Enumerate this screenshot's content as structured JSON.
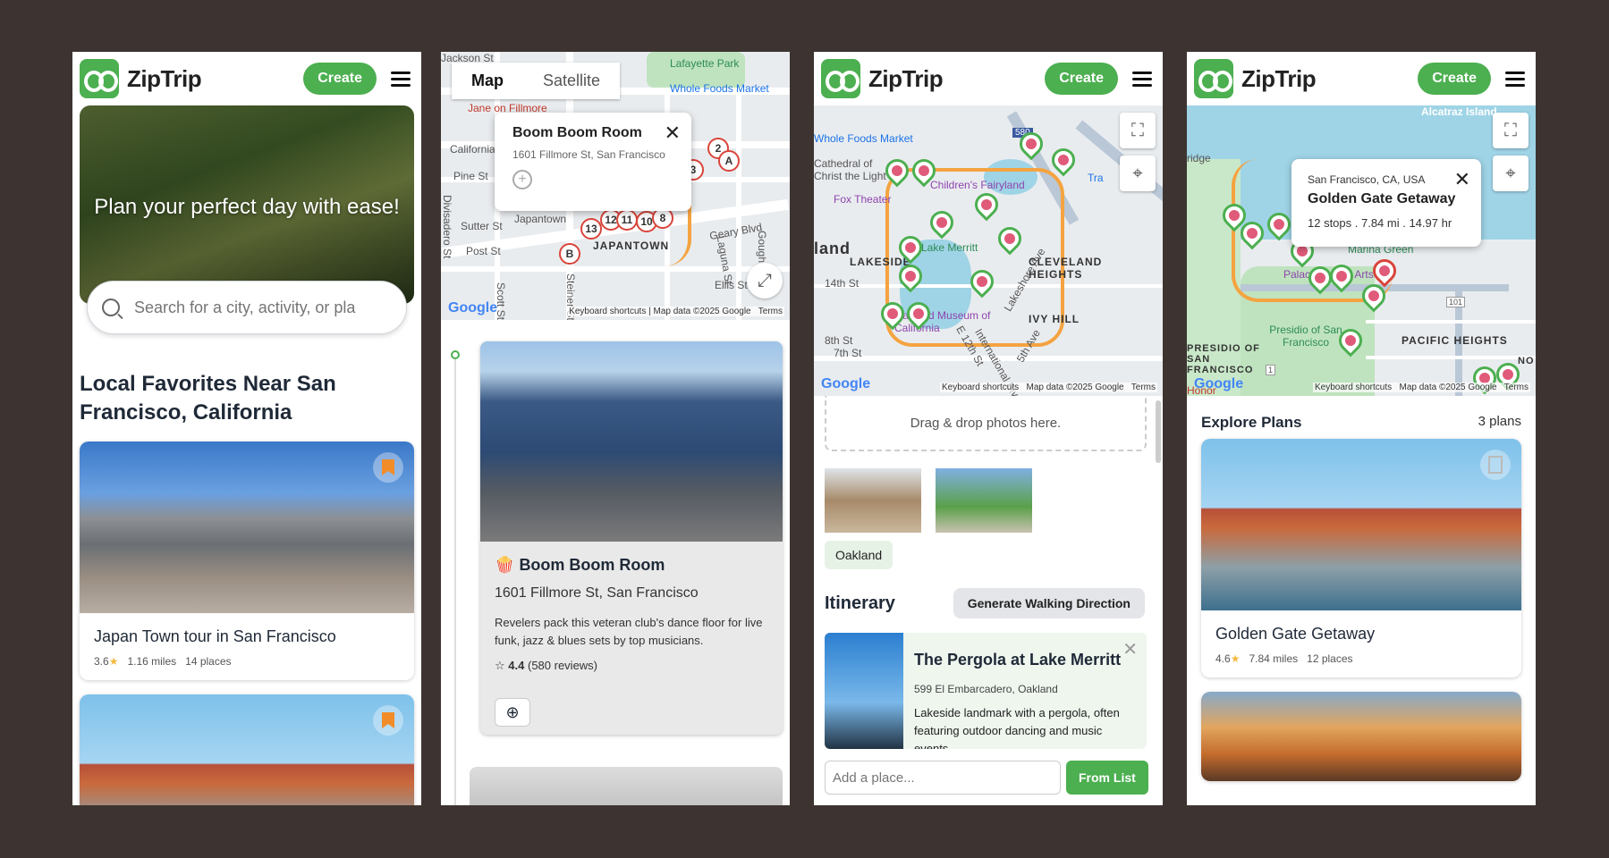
{
  "app": {
    "name": "ZipTrip",
    "create_label": "Create"
  },
  "panel1": {
    "hero_text": "Plan your perfect day with ease!",
    "search_placeholder": "Search for a city, activity, or pla",
    "section_title": "Local Favorites Near San Francisco, California",
    "cards": [
      {
        "title": "Japan Town tour in San Francisco",
        "rating": "3.6",
        "distance": "1.16 miles",
        "places": "14 places"
      },
      {
        "title": "",
        "rating": "",
        "distance": "",
        "places": ""
      }
    ]
  },
  "panel2": {
    "tabs": [
      "Map",
      "Satellite"
    ],
    "map_labels": [
      "Jackson St",
      "Lafayette Park",
      "Whole Foods Market",
      "Jane on Fillmore",
      "California St",
      "Pine St",
      "Sutter St",
      "Post St",
      "Divisadero St",
      "Japantown",
      "JAPANTOWN",
      "Geary Blvd",
      "Laguna St",
      "Ellis St",
      "Gough St",
      "Steiner St",
      "Scott St"
    ],
    "pins": [
      "2",
      "A",
      "3",
      "13",
      "12",
      "11",
      "10",
      "8",
      "B"
    ],
    "info": {
      "title": "Boom Boom Room",
      "address": "1601 Fillmore St, San Francisco"
    },
    "place": {
      "title": "Boom Boom Room",
      "address": "1601 Fillmore St, San Francisco",
      "description": "Revelers pack this veteran club's dance floor for live funk, jazz & blues sets by top musicians.",
      "rating": "4.4",
      "reviews": "(580 reviews)"
    },
    "attribution": {
      "shortcuts": "Keyboard shortcuts",
      "data": "Map data ©2025 Google",
      "terms": "Terms"
    }
  },
  "panel3": {
    "map_labels": [
      "Whole Foods Market",
      "Cathedral of Christ the Light",
      "Children's Fairyland",
      "Fox Theater",
      "Lake Merritt",
      "LAKESIDE",
      "CLEVELAND HEIGHTS",
      "IVY HILL",
      "Oakland Museum of California",
      "14th St",
      "8th St",
      "7th St",
      "5th Ave",
      "E 12th St",
      "International Blvd",
      "Lakeshore Ave",
      "land",
      "Tra",
      "580"
    ],
    "drop_text": "Drag & drop photos here.",
    "tag": "Oakland",
    "itinerary_title": "Itinerary",
    "generate_label": "Generate Walking Direction",
    "item": {
      "title": "The Pergola at Lake Merritt",
      "address": "599 El Embarcadero, Oakland",
      "description": "Lakeside landmark with a pergola, often featuring outdoor dancing and music events."
    },
    "add_placeholder": "Add a place...",
    "from_list_label": "From List",
    "attribution": {
      "shortcuts": "Keyboard shortcuts",
      "data": "Map data ©2025 Google",
      "terms": "Terms"
    }
  },
  "panel4": {
    "map_labels": [
      "Alcatraz Island",
      "Palace of Fine Arts",
      "Marina Green",
      "Presidio of San Francisco",
      "PACIFIC HEIGHTS",
      "PRESIDIO OF SAN FRANCISCO",
      "101",
      "1",
      "ridge",
      "Honor",
      "NO"
    ],
    "info": {
      "city": "San Francisco, CA, USA",
      "title": "Golden Gate Getaway",
      "stats": "12 stops . 7.84 mi . 14.97 hr"
    },
    "explore_title": "Explore Plans",
    "plan_count": "3 plans",
    "cards": [
      {
        "title": "Golden Gate Getaway",
        "rating": "4.6",
        "distance": "7.84 miles",
        "places": "12 places"
      }
    ],
    "attribution": {
      "shortcuts": "Keyboard shortcuts",
      "data": "Map data ©2025 Google",
      "terms": "Terms"
    }
  },
  "colors": {
    "brand": "#4caf50",
    "route": "#f4a340",
    "bookmark": "#f28c28",
    "background": "#3d3431"
  },
  "icons": [
    "logo-icon",
    "menu-icon",
    "search-icon",
    "bookmark-icon",
    "close-icon",
    "add-icon",
    "fullscreen-icon",
    "locate-icon",
    "star-icon",
    "popcorn-icon"
  ]
}
